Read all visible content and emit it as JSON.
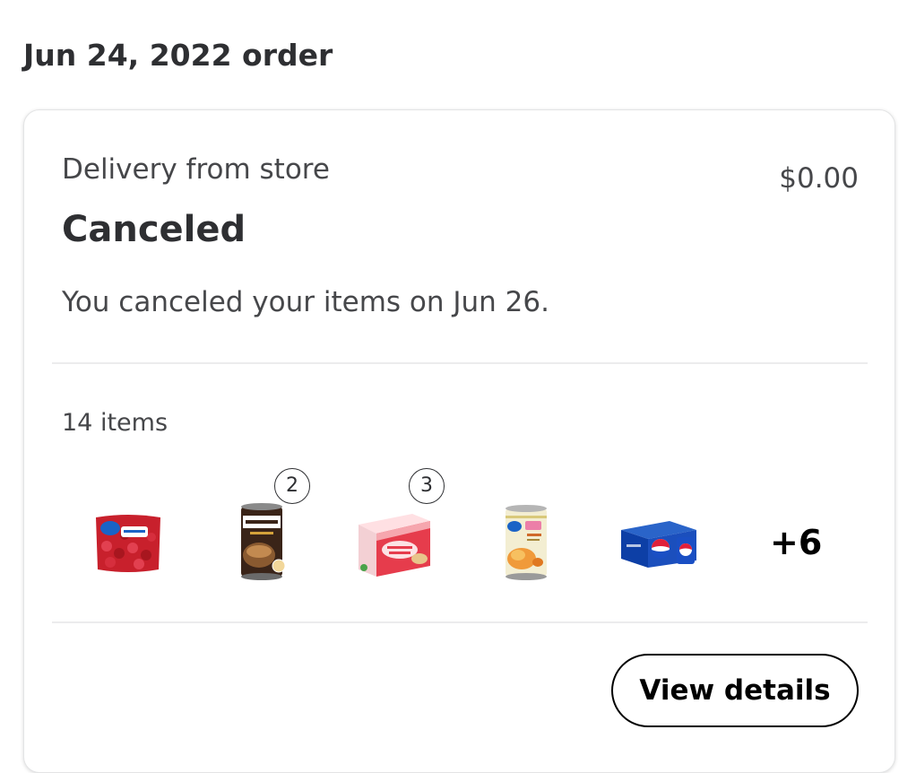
{
  "header": {
    "title": "Jun 24, 2022 order"
  },
  "order": {
    "fulfillment": "Delivery from store",
    "total": "$0.00",
    "status": "Canceled",
    "status_message": "You canceled your items on Jun 26.",
    "item_count": "14 items",
    "items": [
      {
        "icon": "frozen-strawberries-bag",
        "quantity": null
      },
      {
        "icon": "manwich-can",
        "quantity": "2"
      },
      {
        "icon": "jammy-sammy-box",
        "quantity": "3"
      },
      {
        "icon": "peaches-can",
        "quantity": null
      },
      {
        "icon": "pepsi-12-pack",
        "quantity": null
      }
    ],
    "more_items": "+6",
    "view_details_label": "View details"
  },
  "colors": {
    "text_primary": "#2e2f32",
    "text_secondary": "#46474a",
    "divider": "#ececed"
  }
}
